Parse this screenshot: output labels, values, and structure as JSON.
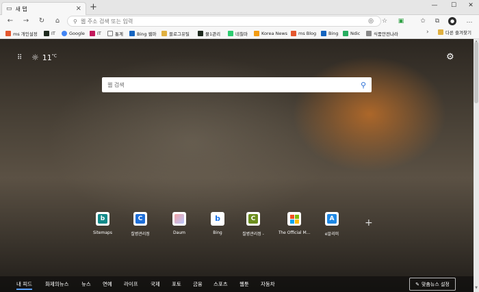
{
  "tabs": [
    {
      "label": "새 탭"
    }
  ],
  "window": {
    "minimize": "—",
    "maximize": "☐",
    "close": "✕"
  },
  "address": {
    "placeholder": "웹 주소 검색 또는 입력"
  },
  "bookmarks": [
    {
      "label": "ms 개인설정",
      "color": "#e4572e"
    },
    {
      "label": "IT",
      "color": "#1f2a1f"
    },
    {
      "label": "Google",
      "color": "#4285f4"
    },
    {
      "label": "IT",
      "color": "#c2185b"
    },
    {
      "label": "통계",
      "color": "#777777"
    },
    {
      "label": "Bing 웹마",
      "color": "#1565c0"
    },
    {
      "label": "블로그유틸",
      "color": "#e0b040"
    },
    {
      "label": "물1관리",
      "color": "#1f2a1f"
    },
    {
      "label": "네칠마",
      "color": "#2ecc71"
    },
    {
      "label": "Korea News",
      "color": "#f39c12"
    },
    {
      "label": "ms Blog",
      "color": "#e4572e"
    },
    {
      "label": "Bing",
      "color": "#1565c0"
    },
    {
      "label": "Ndic",
      "color": "#27ae60"
    },
    {
      "label": "식품안전나라",
      "color": "#888888"
    }
  ],
  "bookmarks_other": {
    "label": "다른 즐겨찾기"
  },
  "weather": {
    "temp": "11",
    "unit": "°C"
  },
  "search": {
    "placeholder": "웹 검색"
  },
  "quick_links": [
    {
      "label": "Sitemaps",
      "glyph": "b",
      "color": "#138a8a"
    },
    {
      "label": "칠병관리정",
      "glyph": "C",
      "color": "#1e6fd9"
    },
    {
      "label": "Daum",
      "glyph": "",
      "color": "#f2b3a3"
    },
    {
      "label": "Bing",
      "glyph": "b",
      "color": "#1a73e8"
    },
    {
      "label": "칠병관리정 -",
      "glyph": "C",
      "color": "#6d8f1f"
    },
    {
      "label": "The Official M...",
      "glyph": "",
      "color": "#f25022"
    },
    {
      "label": "e알리미",
      "glyph": "A",
      "color": "#1e88e5"
    }
  ],
  "feed": {
    "items": [
      "내 피드",
      "화제의뉴스",
      "뉴스",
      "연예",
      "라이프",
      "국제",
      "포토",
      "금융",
      "스포츠",
      "웹툰",
      "자동차"
    ],
    "settings_label": "맞춤뉴스 설정"
  }
}
